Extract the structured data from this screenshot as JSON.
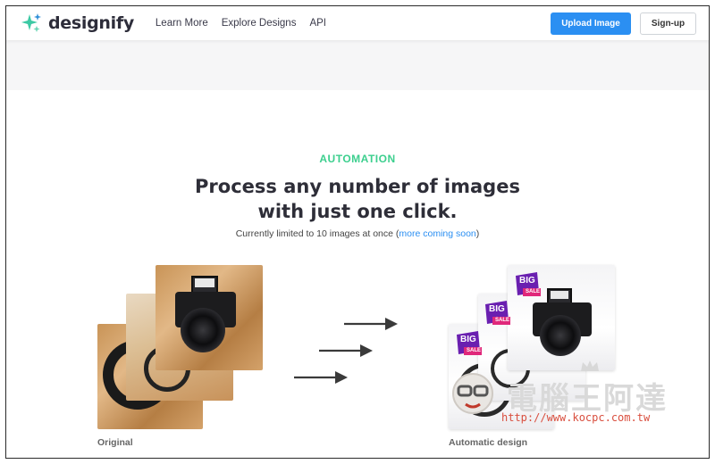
{
  "header": {
    "logo_text": "designify",
    "nav": [
      "Learn More",
      "Explore Designs",
      "API"
    ],
    "upload_label": "Upload Image",
    "signup_label": "Sign-up"
  },
  "hero": {
    "eyebrow": "AUTOMATION",
    "headline_line1": "Process any number of images",
    "headline_line2": "with just one click.",
    "subline_prefix": "Currently limited to 10 images at once (",
    "subline_link": "more coming soon",
    "subline_suffix": ")"
  },
  "demo": {
    "original_caption": "Original",
    "automatic_caption": "Automatic design",
    "badge_top": "BIG",
    "badge_bottom": "SALE",
    "arrow_count": 3
  },
  "watermark": {
    "text": "電腦王阿達",
    "url": "http://www.kocpc.com.tw"
  },
  "colors": {
    "accent_blue": "#2b8ff2",
    "accent_green": "#3ccf8e",
    "badge_purple": "#6a1fb0",
    "badge_pink": "#e0287a"
  }
}
